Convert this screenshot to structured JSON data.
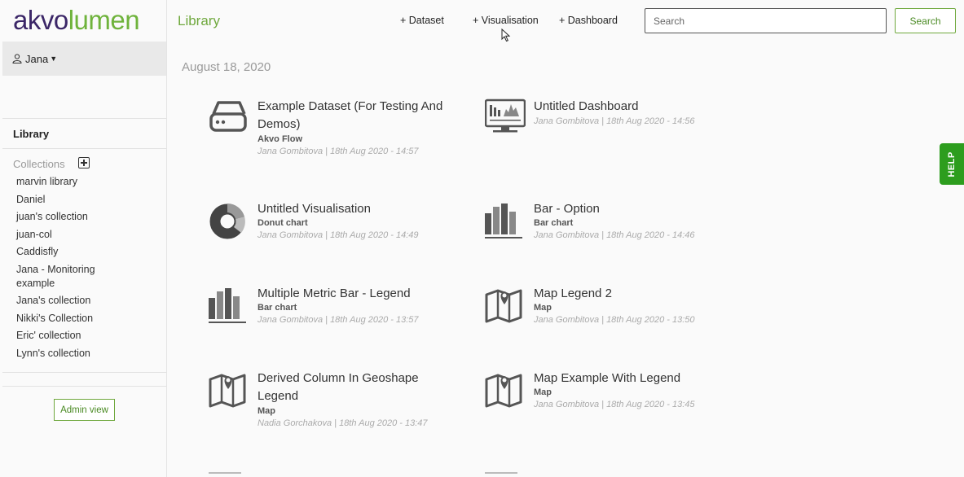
{
  "logo": {
    "part1": "akvo",
    "part2": "lumen"
  },
  "user": {
    "name": "Jana"
  },
  "sidebar": {
    "library_label": "Library",
    "collections_label": "Collections",
    "collections": [
      "marvin library",
      "Daniel",
      "juan's collection",
      "juan-col",
      "Caddisfly",
      "Jana - Monitoring example",
      "Jana's collection",
      "Nikki's Collection",
      "Eric' collection",
      "Lynn's collection"
    ],
    "admin_label": "Admin view"
  },
  "header": {
    "title": "Library",
    "add_dataset": "+ Dataset",
    "add_visualisation": "+ Visualisation",
    "add_dashboard": "+ Dashboard",
    "search_placeholder": "Search",
    "search_button": "Search"
  },
  "date_group": "August 18, 2020",
  "items": [
    {
      "icon": "dataset-icon",
      "name": "Example Dataset (For Testing And Demos)",
      "sub": "Akvo Flow",
      "meta": "Jana Gombitova | 18th Aug 2020 - 14:57"
    },
    {
      "icon": "dashboard-icon",
      "name": "Untitled Dashboard",
      "sub": "",
      "meta": "Jana Gombitova | 18th Aug 2020 - 14:56"
    },
    {
      "icon": "donut-chart-icon",
      "name": "Untitled Visualisation",
      "sub": "Donut chart",
      "meta": "Jana Gombitova | 18th Aug 2020 - 14:49"
    },
    {
      "icon": "bar-chart-icon",
      "name": "Bar - Option",
      "sub": "Bar chart",
      "meta": "Jana Gombitova | 18th Aug 2020 - 14:46"
    },
    {
      "icon": "bar-chart-icon",
      "name": "Multiple Metric Bar - Legend",
      "sub": "Bar chart",
      "meta": "Jana Gombitova | 18th Aug 2020 - 13:57"
    },
    {
      "icon": "map-icon",
      "name": "Map Legend 2",
      "sub": "Map",
      "meta": "Jana Gombitova | 18th Aug 2020 - 13:50"
    },
    {
      "icon": "map-icon",
      "name": "Derived Column In Geoshape Legend",
      "sub": "Map",
      "meta": "Nadia Gorchakova | 18th Aug 2020 - 13:47"
    },
    {
      "icon": "map-icon",
      "name": "Map Example With Legend",
      "sub": "Map",
      "meta": "Jana Gombitova | 18th Aug 2020 - 13:45"
    }
  ],
  "help_label": "HELP",
  "colors": {
    "brand_purple": "#3b2667",
    "brand_green": "#6fb33c",
    "help_green": "#2d9d1e"
  }
}
